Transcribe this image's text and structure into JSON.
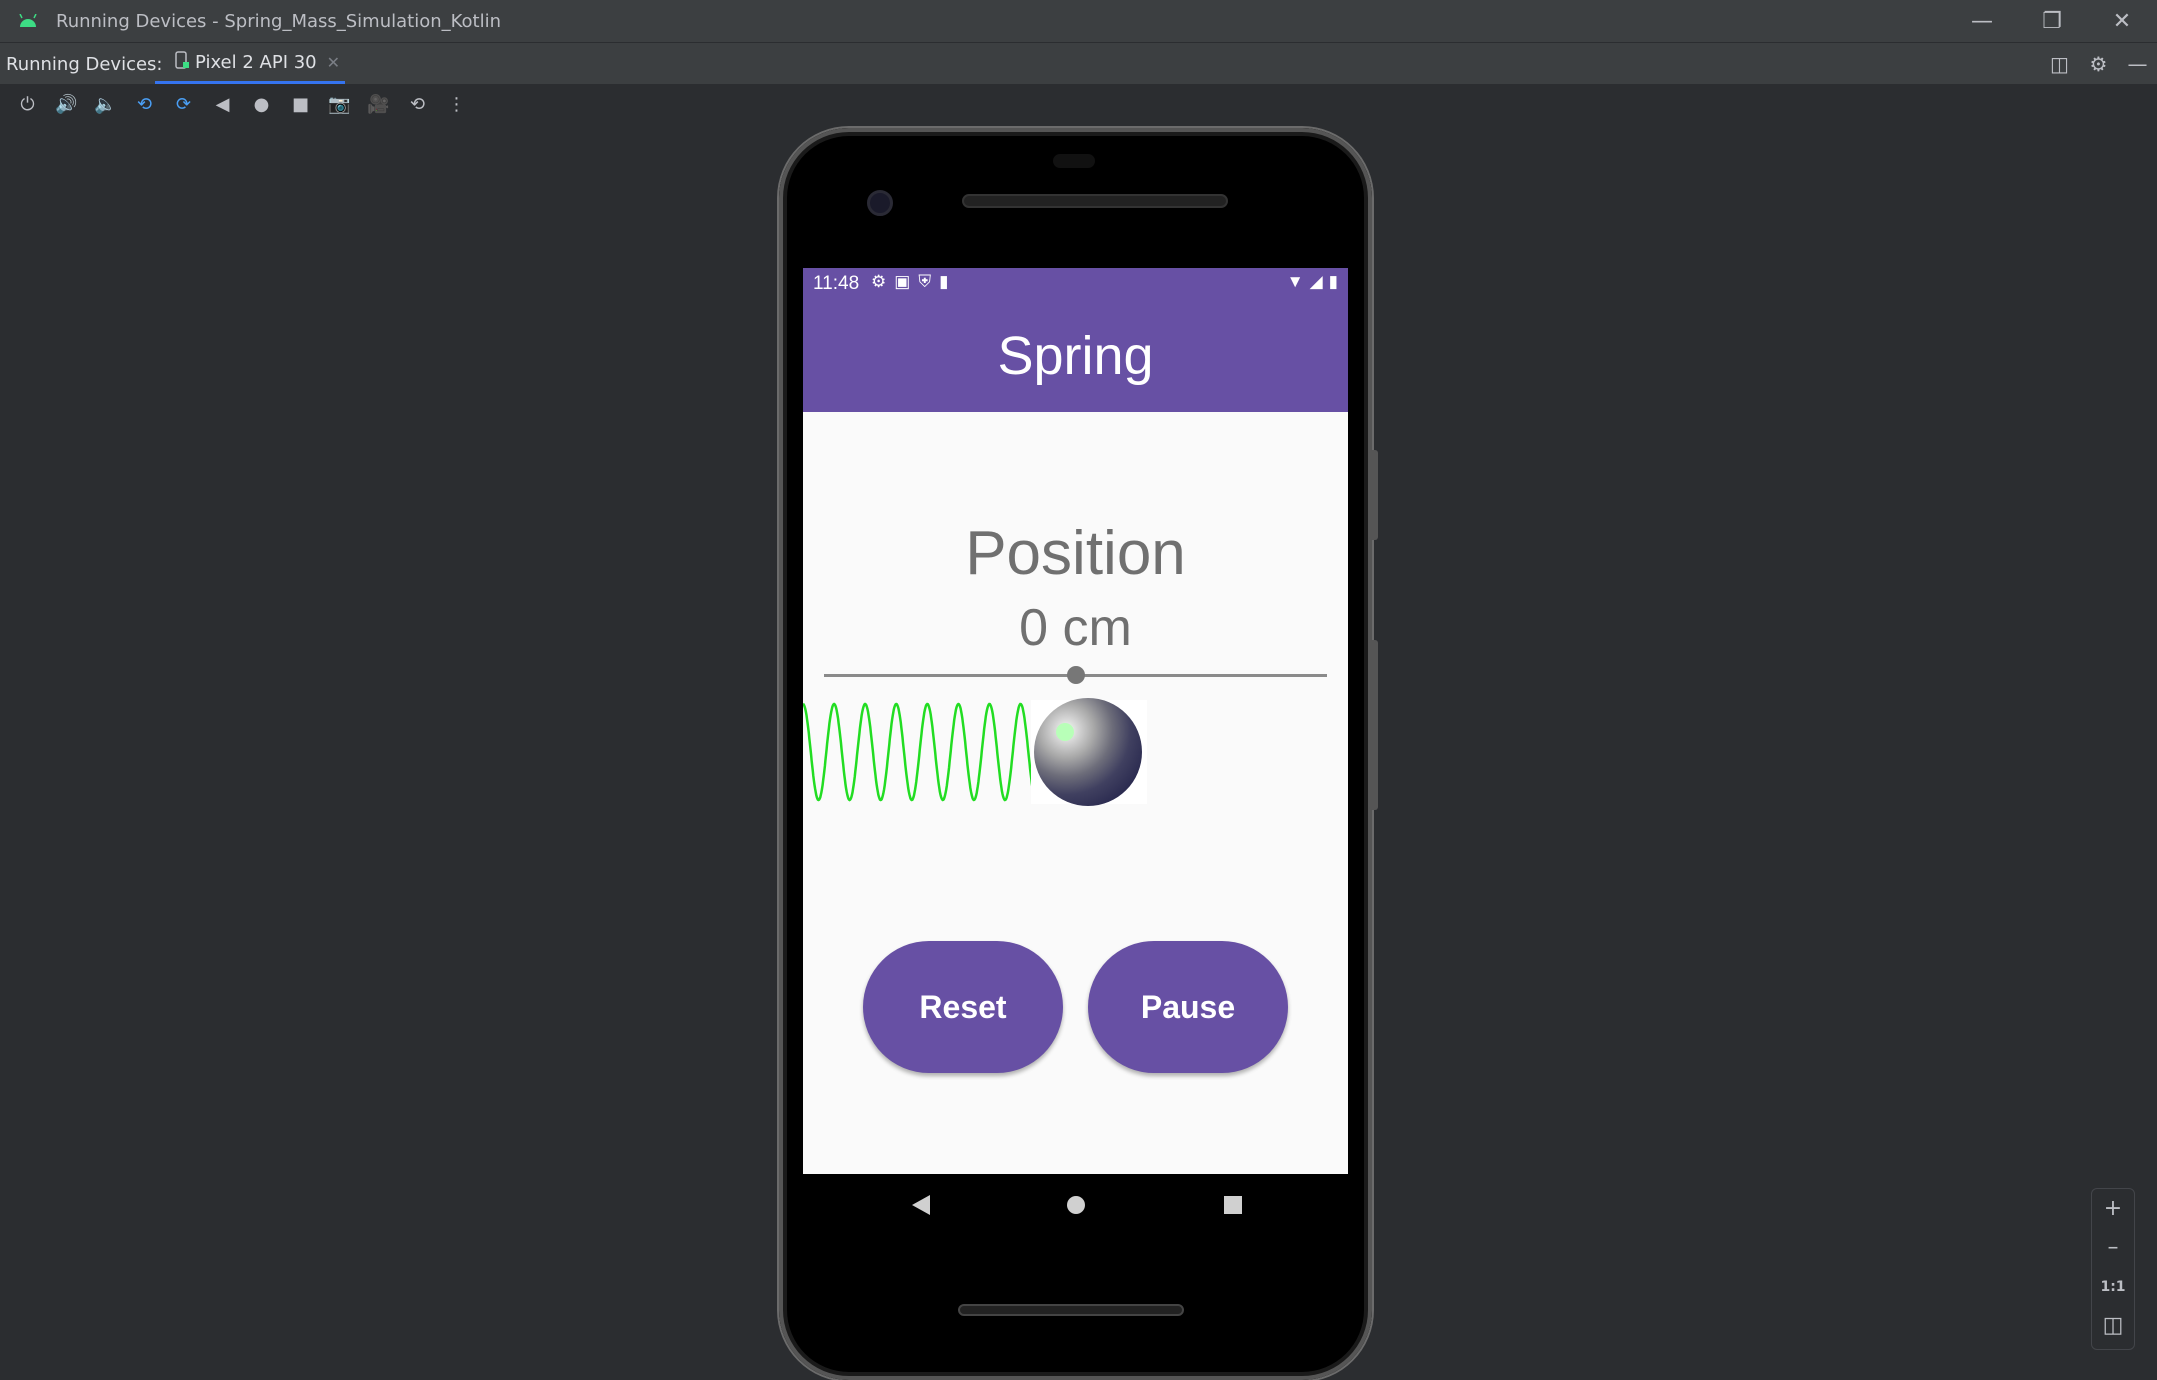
{
  "window": {
    "title": "Running Devices - Spring_Mass_Simulation_Kotlin",
    "minimize_icon": "minimize-icon",
    "restore_icon": "restore-icon",
    "close_icon": "close-icon"
  },
  "tabbar": {
    "label": "Running Devices:",
    "device_tab": "Pixel 2 API 30"
  },
  "toolbar": {
    "tools": [
      "power-icon",
      "volume-up-icon",
      "volume-down-icon",
      "rotate-left-icon",
      "rotate-right-icon",
      "back-icon",
      "home-icon",
      "overview-icon",
      "screenshot-icon",
      "screen-record-icon",
      "snapshot-icon",
      "more-icon"
    ]
  },
  "device": {
    "status_time": "11:48",
    "app_title": "Spring",
    "position_label": "Position",
    "position_value": "0 cm",
    "slider_fraction": 0.5,
    "reset_label": "Reset",
    "pause_label": "Pause"
  },
  "zoom": {
    "one_to_one": "1:1"
  },
  "colors": {
    "accent": "#6750a4",
    "spring": "#22dd22",
    "ide_bg": "#2b2d30",
    "tab_underline": "#3574f0"
  }
}
